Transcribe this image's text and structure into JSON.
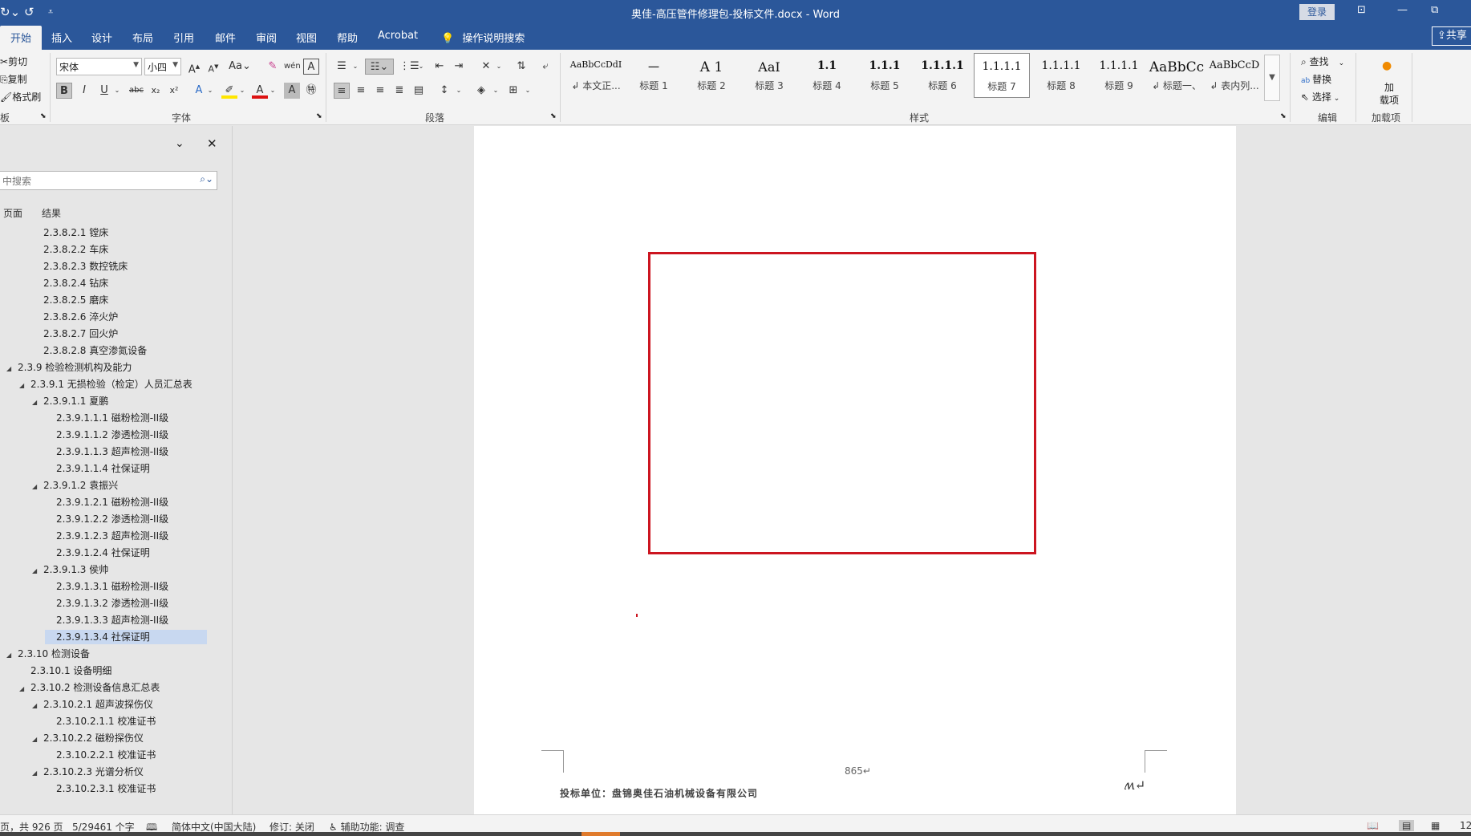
{
  "titlebar": {
    "title": "奥佳-高压管件修理包-投标文件.docx  -  Word",
    "login": "登录"
  },
  "tabs": [
    "开始",
    "插入",
    "设计",
    "布局",
    "引用",
    "邮件",
    "审阅",
    "视图",
    "帮助",
    "Acrobat"
  ],
  "tell_me": "操作说明搜索",
  "share": "共享",
  "ribbon": {
    "clipboard": {
      "cut": "剪切",
      "copy": "复制",
      "format_painter": "格式刷",
      "label": "板"
    },
    "font": {
      "name": "宋体",
      "size": "小四",
      "label": "字体",
      "case": "Aa"
    },
    "paragraph": {
      "label": "段落"
    },
    "styles": {
      "label": "样式",
      "items": [
        {
          "sample": "AaBbCcDdI",
          "name": "↲ 本文正..."
        },
        {
          "sample": "一",
          "name": "标题 1"
        },
        {
          "sample": "A 1",
          "name": "标题 2"
        },
        {
          "sample": "AaI",
          "name": "标题 3"
        },
        {
          "sample": "1.1",
          "name": "标题 4"
        },
        {
          "sample": "1.1.1",
          "name": "标题 5"
        },
        {
          "sample": "1.1.1.1",
          "name": "标题 6"
        },
        {
          "sample": "1.1.1.1",
          "name": "标题 7"
        },
        {
          "sample": "1.1.1.1",
          "name": "标题 8"
        },
        {
          "sample": "1.1.1.1",
          "name": "标题 9"
        },
        {
          "sample": "AaBbCc",
          "name": "↲ 标题一、"
        },
        {
          "sample": "AaBbCcD",
          "name": "↲ 表内列..."
        }
      ],
      "selected_index": 6
    },
    "editing": {
      "find": "查找",
      "replace": "替换",
      "select": "选择",
      "label": "编辑"
    },
    "addins": {
      "btn_line1": "加",
      "btn_line2": "载项",
      "label": "加载项"
    }
  },
  "nav": {
    "search_placeholder": "中搜索",
    "tabs": [
      "页面",
      "结果"
    ],
    "items": [
      {
        "level": 3,
        "text": "2.3.8.2.1 镗床",
        "expand": ""
      },
      {
        "level": 3,
        "text": "2.3.8.2.2 车床",
        "expand": ""
      },
      {
        "level": 3,
        "text": "2.3.8.2.3 数控铣床",
        "expand": ""
      },
      {
        "level": 3,
        "text": "2.3.8.2.4 钻床",
        "expand": ""
      },
      {
        "level": 3,
        "text": "2.3.8.2.5 磨床",
        "expand": ""
      },
      {
        "level": 3,
        "text": "2.3.8.2.6 淬火炉",
        "expand": ""
      },
      {
        "level": 3,
        "text": "2.3.8.2.7 回火炉",
        "expand": ""
      },
      {
        "level": 3,
        "text": "2.3.8.2.8 真空渗氮设备",
        "expand": ""
      },
      {
        "level": 1,
        "text": "2.3.9 检验检测机构及能力",
        "expand": "◢"
      },
      {
        "level": 2,
        "text": "2.3.9.1 无损检验（检定）人员汇总表",
        "expand": "◢"
      },
      {
        "level": 3,
        "text": "2.3.9.1.1 夏鹏",
        "expand": "◢"
      },
      {
        "level": 4,
        "text": "2.3.9.1.1.1 磁粉检测-II级",
        "expand": ""
      },
      {
        "level": 4,
        "text": "2.3.9.1.1.2 渗透检测-II级",
        "expand": ""
      },
      {
        "level": 4,
        "text": "2.3.9.1.1.3 超声检测-II级",
        "expand": ""
      },
      {
        "level": 4,
        "text": "2.3.9.1.1.4 社保证明",
        "expand": ""
      },
      {
        "level": 3,
        "text": "2.3.9.1.2 袁振兴",
        "expand": "◢"
      },
      {
        "level": 4,
        "text": "2.3.9.1.2.1 磁粉检测-II级",
        "expand": ""
      },
      {
        "level": 4,
        "text": "2.3.9.1.2.2 渗透检测-II级",
        "expand": ""
      },
      {
        "level": 4,
        "text": "2.3.9.1.2.3 超声检测-II级",
        "expand": ""
      },
      {
        "level": 4,
        "text": "2.3.9.1.2.4 社保证明",
        "expand": ""
      },
      {
        "level": 3,
        "text": "2.3.9.1.3 侯帅",
        "expand": "◢"
      },
      {
        "level": 4,
        "text": "2.3.9.1.3.1 磁粉检测-II级",
        "expand": ""
      },
      {
        "level": 4,
        "text": "2.3.9.1.3.2 渗透检测-II级",
        "expand": ""
      },
      {
        "level": 4,
        "text": "2.3.9.1.3.3 超声检测-II级",
        "expand": ""
      },
      {
        "level": 4,
        "text": "2.3.9.1.3.4 社保证明",
        "expand": "",
        "selected": true
      },
      {
        "level": 1,
        "text": "2.3.10 检测设备",
        "expand": "◢"
      },
      {
        "level": 2,
        "text": "2.3.10.1 设备明细",
        "expand": ""
      },
      {
        "level": 2,
        "text": "2.3.10.2 检测设备信息汇总表",
        "expand": "◢"
      },
      {
        "level": 3,
        "text": "2.3.10.2.1 超声波探伤仪",
        "expand": "◢"
      },
      {
        "level": 4,
        "text": "2.3.10.2.1.1 校准证书",
        "expand": ""
      },
      {
        "level": 3,
        "text": "2.3.10.2.2 磁粉探伤仪",
        "expand": "◢"
      },
      {
        "level": 4,
        "text": "2.3.10.2.2.1 校准证书",
        "expand": ""
      },
      {
        "level": 3,
        "text": "2.3.10.2.3 光谱分析仪",
        "expand": "◢"
      },
      {
        "level": 4,
        "text": "2.3.10.2.3.1 校准证书",
        "expand": ""
      }
    ]
  },
  "document": {
    "page_number": "865↵",
    "footer": "投标单位：盘锦奥佳石油机械设备有限公司",
    "signature": "ʍ↵"
  },
  "status": {
    "pages": "页，共 926 页",
    "words": "5/29461 个字",
    "language": "简体中文(中国大陆)",
    "track_changes": "修订: 关闭",
    "accessibility": "辅助功能: 调查",
    "zoom": "12"
  },
  "colors": {
    "word_blue": "#2b579a",
    "frame_red": "#cc1520"
  }
}
